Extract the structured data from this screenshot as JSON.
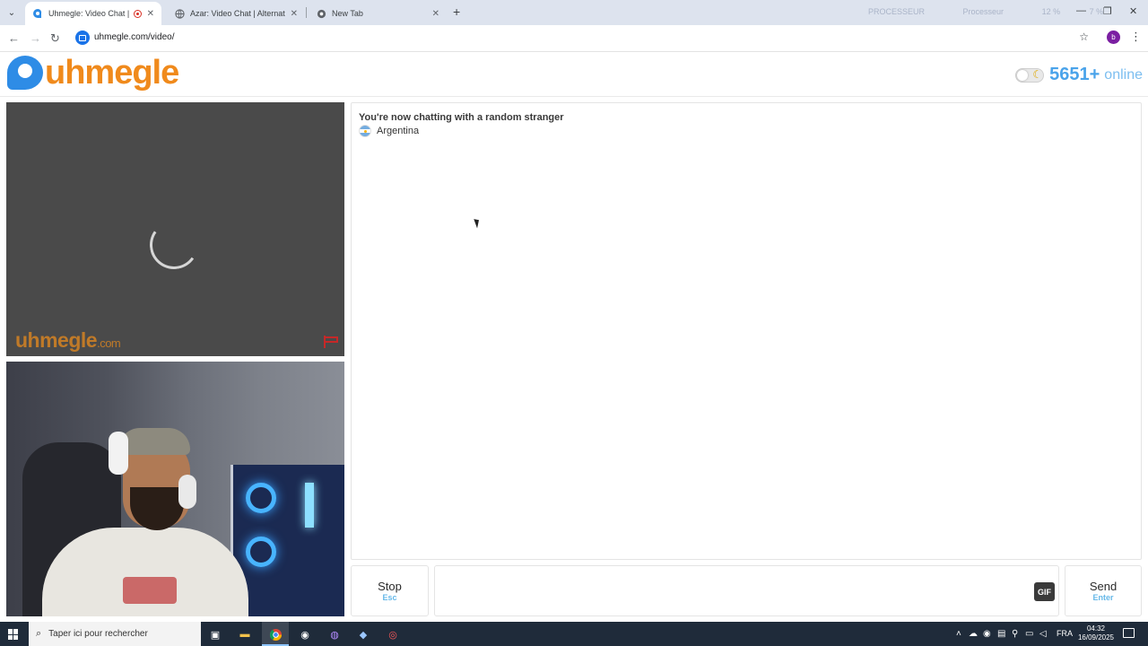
{
  "browser": {
    "tabs": [
      {
        "title": "Uhmegle: Video Chat | Om...",
        "active": true,
        "recording": true
      },
      {
        "title": "Azar: Video Chat | Alternative to...",
        "active": false
      },
      {
        "title": "New Tab",
        "active": false
      }
    ],
    "new_tab_glyph": "+",
    "url": "uhmegle.com/video/",
    "profile_initial": "b",
    "overlay_widget": {
      "a": "PROCESSEUR",
      "b": "12 %",
      "c": "Processeur",
      "d": "7 %"
    }
  },
  "site": {
    "logo_text": "uhmegle",
    "online_count": "5651+",
    "online_label": "online",
    "watermark": {
      "main": "uhmegle",
      "suffix": ".com"
    }
  },
  "chat": {
    "status": "You're now chatting with a random stranger",
    "country": "Argentina",
    "message_placeholder": ""
  },
  "controls": {
    "stop_label": "Stop",
    "stop_key": "Esc",
    "gif_label": "GIF",
    "send_label": "Send",
    "send_key": "Enter"
  },
  "taskbar": {
    "search_placeholder": "Taper ici pour rechercher",
    "language": "FRA",
    "time": "04:32",
    "date": "16/09/2025"
  },
  "colors": {
    "brand_orange": "#f08a1c",
    "brand_blue": "#2e8ce6",
    "online_blue": "#4aa3ea",
    "key_hint_blue": "#66b8e8"
  },
  "icons": [
    "tab-search-icon",
    "record-icon",
    "back-icon",
    "forward-icon",
    "reload-icon",
    "site-info-icon",
    "bookmark-star-icon",
    "kebab-menu-icon",
    "moon-icon",
    "report-flag-icon",
    "loading-spinner-icon",
    "windows-start-icon",
    "search-icon",
    "task-view-icon",
    "file-explorer-icon",
    "chrome-icon",
    "steam-icon"
  ]
}
